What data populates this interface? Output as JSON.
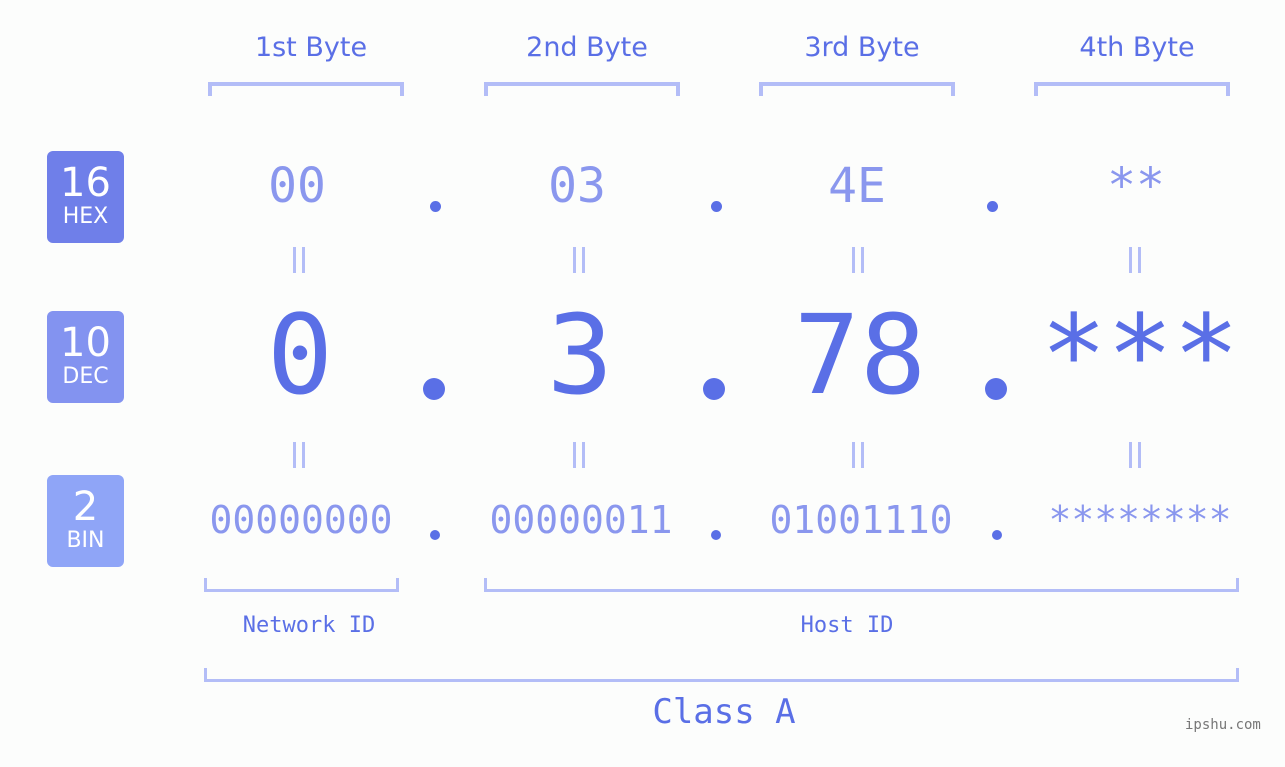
{
  "bytes": [
    {
      "title": "1st Byte",
      "hex": "00",
      "dec": "0",
      "bin": "00000000"
    },
    {
      "title": "2nd Byte",
      "hex": "03",
      "dec": "3",
      "bin": "00000011"
    },
    {
      "title": "3rd Byte",
      "hex": "4E",
      "dec": "78",
      "bin": "01001110"
    },
    {
      "title": "4th Byte",
      "hex": "**",
      "dec": "***",
      "bin": "********"
    }
  ],
  "badges": {
    "hex": {
      "num": "16",
      "label": "HEX",
      "color": "#6f7fe9"
    },
    "dec": {
      "num": "10",
      "label": "DEC",
      "color": "#8393f0"
    },
    "bin": {
      "num": "2",
      "label": "BIN",
      "color": "#8fa5f7"
    }
  },
  "labels": {
    "network_id": "Network ID",
    "host_id": "Host ID",
    "class": "Class A"
  },
  "watermark": "ipshu.com",
  "colors": {
    "primary": "#5a6fe6",
    "light": "#8a97ee",
    "bracket": "#b3bdf7"
  }
}
